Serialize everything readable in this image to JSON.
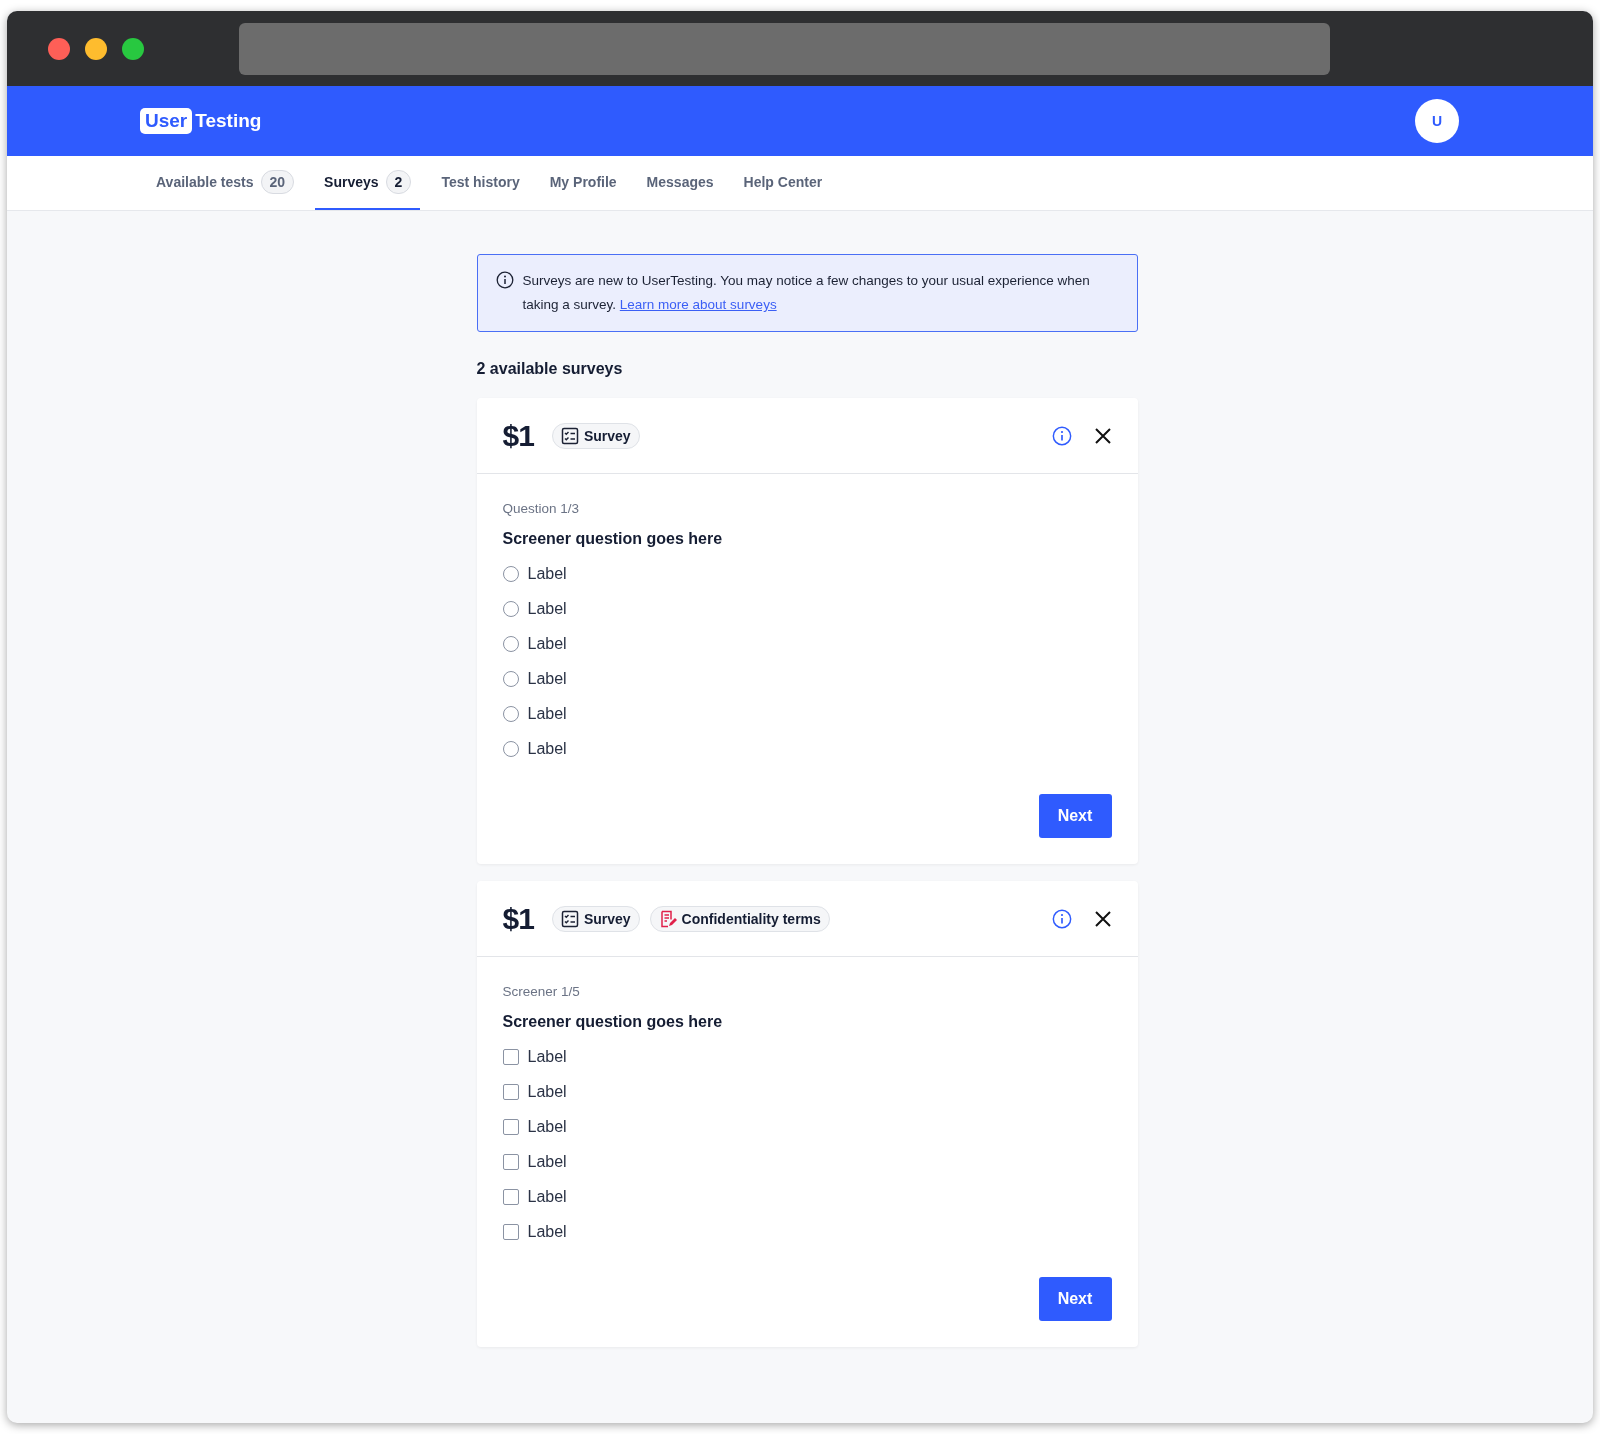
{
  "logo": {
    "part_1": "User",
    "part_2": "Testing"
  },
  "avatar": {
    "initial": "U"
  },
  "tabs": [
    {
      "label": "Available tests",
      "count": "20",
      "selected": false
    },
    {
      "label": "Surveys",
      "count": "2",
      "selected": true
    },
    {
      "label": "Test history",
      "selected": false
    },
    {
      "label": "My Profile",
      "selected": false
    },
    {
      "label": "Messages",
      "selected": false
    },
    {
      "label": "Help Center",
      "selected": false
    }
  ],
  "banner": {
    "text": "Surveys are new to UserTesting. You may notice a few changes to your usual experience when taking a survey.",
    "link": "Learn more about surveys"
  },
  "heading": "2 available surveys",
  "surveys": [
    {
      "price": "$1",
      "tags": [
        {
          "kind": "survey",
          "label": "Survey"
        }
      ],
      "progress": "Question 1/3",
      "question": "Screener question goes here",
      "options": [
        {
          "kind": "radio",
          "label": "Label",
          "checked": false
        },
        {
          "kind": "radio",
          "label": "Label",
          "checked": false
        },
        {
          "kind": "radio",
          "label": "Label",
          "checked": false
        },
        {
          "kind": "radio",
          "label": "Label",
          "checked": false
        },
        {
          "kind": "radio",
          "label": "Label",
          "checked": false
        },
        {
          "kind": "radio",
          "label": "Label",
          "checked": false
        }
      ],
      "button": "Next"
    },
    {
      "price": "$1",
      "tags": [
        {
          "kind": "survey",
          "label": "Survey"
        },
        {
          "kind": "confidentiality",
          "label": "Confidentiality terms"
        }
      ],
      "progress": "Screener 1/5",
      "question": "Screener question goes here",
      "options": [
        {
          "kind": "checkbox",
          "label": "Label",
          "checked": false
        },
        {
          "kind": "checkbox",
          "label": "Label",
          "checked": false
        },
        {
          "kind": "checkbox",
          "label": "Label",
          "checked": false
        },
        {
          "kind": "checkbox",
          "label": "Label",
          "checked": false
        },
        {
          "kind": "checkbox",
          "label": "Label",
          "checked": false
        },
        {
          "kind": "checkbox",
          "label": "Label",
          "checked": false
        }
      ],
      "button": "Next"
    }
  ]
}
